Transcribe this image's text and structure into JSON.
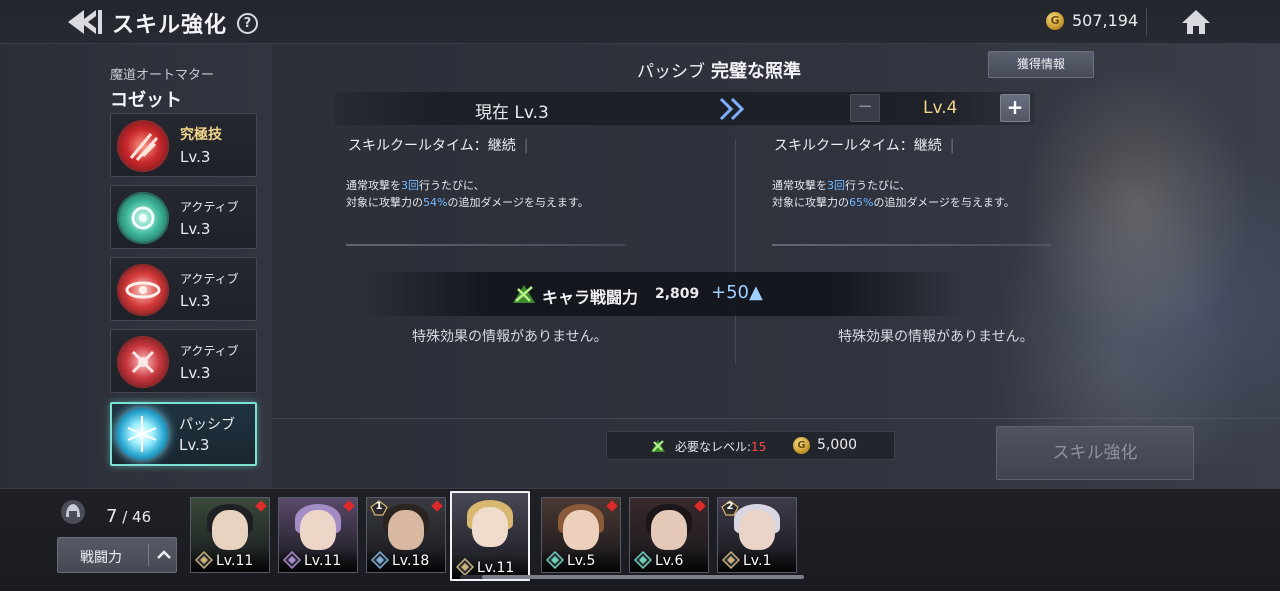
{
  "header": {
    "title": "スキル強化",
    "help": "?",
    "gold_amount": "507,194"
  },
  "character": {
    "class": "魔道オートマター",
    "name": "コゼット"
  },
  "skills": [
    {
      "type": "究極技",
      "level": "Lv.3",
      "color": "#d43a3a",
      "selected": false
    },
    {
      "type": "アクティブ",
      "level": "Lv.3",
      "color": "#3fb89c",
      "selected": false
    },
    {
      "type": "アクティブ",
      "level": "Lv.3",
      "color": "#d43a3a",
      "selected": false
    },
    {
      "type": "アクティブ",
      "level": "Lv.3",
      "color": "#c8383e",
      "selected": false
    },
    {
      "type": "パッシブ",
      "level": "Lv.3",
      "color": "#7fe3ff",
      "selected": true
    }
  ],
  "detail": {
    "category": "パッシブ",
    "name": "完璧な照準",
    "info_button": "獲得情報",
    "current_level": "現在 Lv.3",
    "next_level": "Lv.4",
    "minus": "−",
    "plus": "+",
    "current": {
      "cooldown": "スキルクールタイム：継続",
      "line1_pre": "通常攻撃を",
      "line1_num": "3回",
      "line1_post": "行うたびに、",
      "line2_pre": "対象に攻撃力の",
      "line2_num": "54%",
      "line2_post": "の追加ダメージを与えます。",
      "special": "特殊効果の情報がありません。"
    },
    "next": {
      "cooldown": "スキルクールタイム：継続",
      "line1_pre": "通常攻撃を",
      "line1_num": "3回",
      "line1_post": "行うたびに、",
      "line2_pre": "対象に攻撃力の",
      "line2_num": "65%",
      "line2_post": "の追加ダメージを与えます。",
      "special": "特殊効果の情報がありません。"
    },
    "power_label": "キャラ戦闘力",
    "power_value": "2,809",
    "power_delta": "+50▲"
  },
  "requirement": {
    "label": "必要なレベル:",
    "level": "15",
    "cost": "5,000"
  },
  "upgrade_button": "スキル強化",
  "roster": {
    "count": "7",
    "total": "/ 46",
    "sort_label": "戦闘力",
    "cards": [
      {
        "level": "Lv.11",
        "bg": "#3a4a3a",
        "hair": "#1f2024",
        "skin": "#e8d2c0",
        "red_dot": true,
        "stars": ""
      },
      {
        "level": "Lv.11",
        "bg": "#5a4a6a",
        "hair": "#a48cc4",
        "skin": "#edd6c8",
        "red_dot": true,
        "stars": ""
      },
      {
        "level": "Lv.18",
        "bg": "#3a3a42",
        "hair": "#2b2320",
        "skin": "#d8b8a0",
        "red_dot": true,
        "stars": "1"
      },
      {
        "level": "Lv.11",
        "bg": "#4a4a58",
        "hair": "#d8b870",
        "skin": "#f0dccc",
        "red_dot": false,
        "stars": ""
      },
      {
        "level": "Lv.5",
        "bg": "#4a3832",
        "hair": "#8a5a3a",
        "skin": "#ecd0bc",
        "red_dot": true,
        "stars": ""
      },
      {
        "level": "Lv.6",
        "bg": "#3a2a2e",
        "hair": "#1c1618",
        "skin": "#e4c8b8",
        "red_dot": true,
        "stars": ""
      },
      {
        "level": "Lv.1",
        "bg": "#3e3a4a",
        "hair": "#d8d6e0",
        "skin": "#ead4c8",
        "red_dot": false,
        "stars": "2"
      }
    ]
  }
}
